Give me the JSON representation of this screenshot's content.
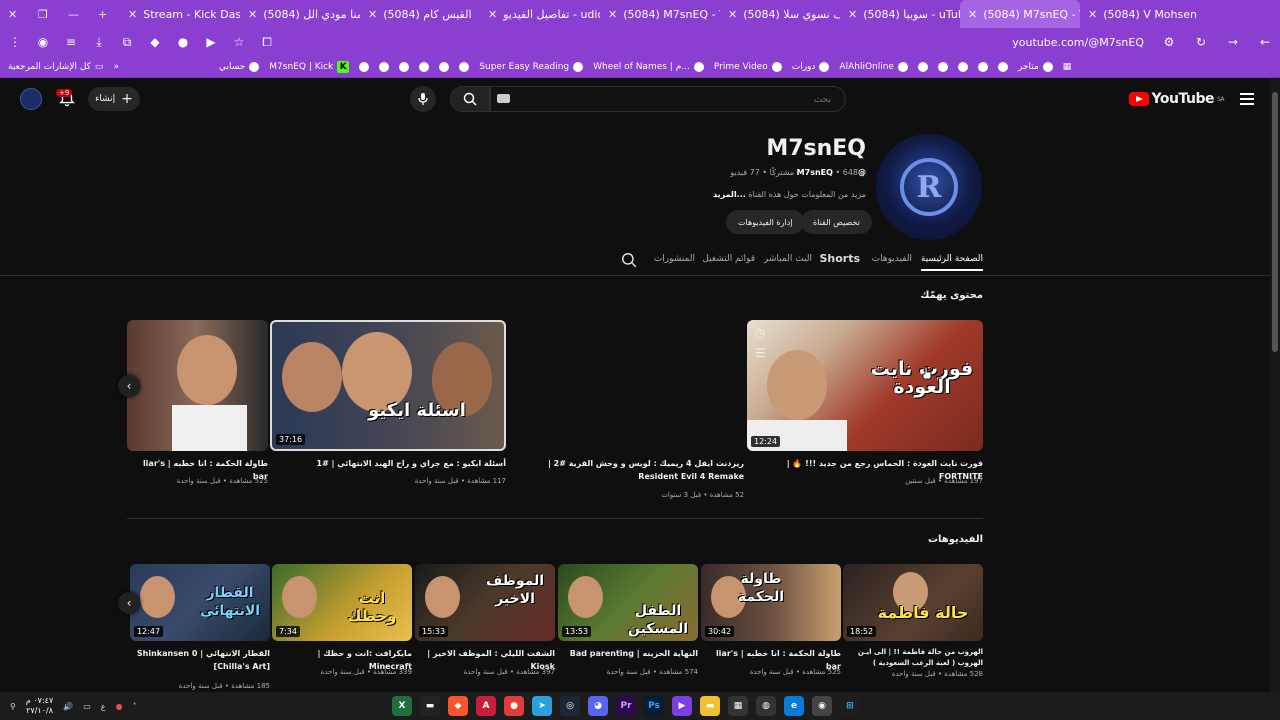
{
  "browser": {
    "tabs": [
      {
        "title": "",
        "icon": "close-icon"
      },
      {
        "title": "Stream - Kick Dashbo",
        "icon": "kick"
      },
      {
        "title": "(5084) داهمنا مودي الل",
        "icon": "youtube"
      },
      {
        "title": "(5084) القيس كام",
        "icon": "youtube"
      },
      {
        "title": "تفاصيل الفيديو - udio",
        "icon": "youtube"
      },
      {
        "title": "(5084) M7snEQ - You",
        "icon": "youtube"
      },
      {
        "title": "(5084) كيف نسوي سلا",
        "icon": "youtube"
      },
      {
        "title": "سوبيا (5084) - uTube",
        "icon": "youtube"
      },
      {
        "title": "(5084) M7snEQ - You",
        "icon": "youtube",
        "active": true
      },
      {
        "title": "(5084) V Mohsen Ah",
        "icon": "youtube"
      }
    ],
    "url": "youtube.com/@M7snEQ",
    "bookmarks_right": [
      "كل الإشارات المرجعية"
    ],
    "bookmarks": [
      "حسابي",
      "M7snEQ | Kick",
      "Super Easy Reading",
      "Wheel of Names | م...",
      "Prime Video",
      "دورات",
      "AlAhliOnline",
      "متاجر"
    ]
  },
  "youtube": {
    "logo_text": "YouTube",
    "logo_region": "SA",
    "search_placeholder": "بحث",
    "create_label": "إنشاء",
    "notif_count": "+9",
    "channel": {
      "name": "M7snEQ",
      "handle": "@M7snEQ",
      "meta_rest": " • 648 مشتركًا • 77 فيديو",
      "desc": "مزيد من المعلومات حول هذه القناة",
      "desc_more": "...المزيد",
      "customize_label": "تخصيص القناة",
      "manage_label": "إدارة الفيديوهات",
      "avatar_letter": "R"
    },
    "tabs": [
      "الصفحة الرئيسية",
      "الفيديوهات",
      "Shorts",
      "البث المباشر",
      "قوائم التشغيل",
      "المنشورات"
    ],
    "section1_title": "محتوى يهمّك",
    "section2_title": "الفيديوهات",
    "featured": [
      {
        "title": "فورت نايت العودة : الحماس رجع من جديد !!! 🔥 | FORTNITE",
        "meta": "197 مشاهدة • قبل سنتين",
        "duration": "12:24",
        "overlay": "فورت نايت العودة"
      },
      {
        "title": "ريزدنت ايفل 4 ريميك : لويس و وحش القرية #2 | Resident Evil 4 Remake",
        "meta": "52 مشاهدة • قبل 3 سنوات",
        "duration": "",
        "overlay": ""
      },
      {
        "title": "أسئلة ايكيو : مع جراي و راح الهبد الانتهائي | #1",
        "meta": "117 مشاهدة • قبل سنة واحدة",
        "duration": "37:16",
        "overlay": "اسئلة ايكيو"
      },
      {
        "title": "طاولة الحكمة : انا خطبه | liar's bar",
        "meta": "525 مشاهدة • قبل سنة واحدة",
        "duration": "",
        "overlay": ""
      }
    ],
    "videos": [
      {
        "title": "الهروب من حالة فاطمة !! | الى ايـن الهروب ( لعبة الرعب السعودية )",
        "meta": "528 مشاهدة • قبل سنة واحدة",
        "duration": "18:52",
        "overlay": "حالة فاطمة"
      },
      {
        "title": "طاولة الحكمة : انا خطبه | liar's bar",
        "meta": "525 مشاهدة • قبل سنة واحدة",
        "duration": "30:42",
        "overlay": "طاولة الحكمة"
      },
      {
        "title": "النهاية الحزينه | Bad parenting",
        "meta": "574 مشاهدة • قبل سنة واحدة",
        "duration": "13:53",
        "overlay": "الطفل المسكين"
      },
      {
        "title": "الشفت الليلي : الموظف الاخير | Kiosk",
        "meta": "397 مشاهدة • قبل سنة واحدة",
        "duration": "15:33",
        "overlay": "الموظف الاخير"
      },
      {
        "title": "مايكرافت :انت و حظك | Minecraft",
        "meta": "339 مشاهدة • قبل سنة واحدة",
        "duration": "7:34",
        "overlay": "انت وحظك"
      },
      {
        "title": "القطار الانتهائي | Shinkansen 0 [Chilla's Art]",
        "meta": "185 مشاهدة • قبل سنة واحدة",
        "duration": "12:47",
        "overlay": "القطار الانتهائي"
      }
    ]
  },
  "taskbar": {
    "time": "٠٧:٤٧ م",
    "date": "٢٧/١٠/٨"
  },
  "colors": {
    "browser_purple": "#8a3fd1",
    "yt_red": "#ff0000",
    "bg": "#0f0f0f"
  }
}
